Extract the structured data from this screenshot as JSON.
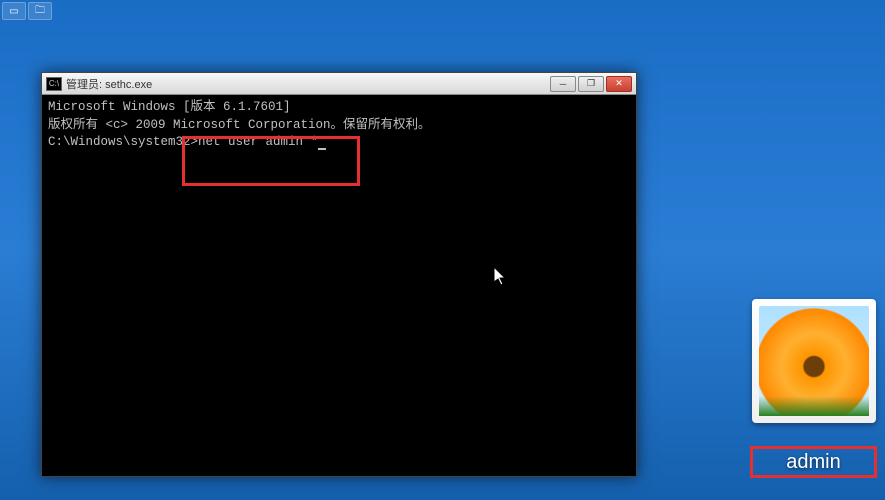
{
  "taskbar": {
    "icons": [
      "window",
      "folder"
    ]
  },
  "cmd": {
    "title": "管理员: sethc.exe",
    "lines": {
      "l1": "Microsoft Windows [版本 6.1.7601]",
      "l2": "版权所有 <c> 2009 Microsoft Corporation。保留所有权利。",
      "l3": "",
      "prompt": "C:\\Windows\\system32>",
      "command": "net user admin *"
    },
    "controls": {
      "min": "─",
      "max": "❐",
      "close": "✕"
    }
  },
  "user": {
    "name": "admin"
  }
}
